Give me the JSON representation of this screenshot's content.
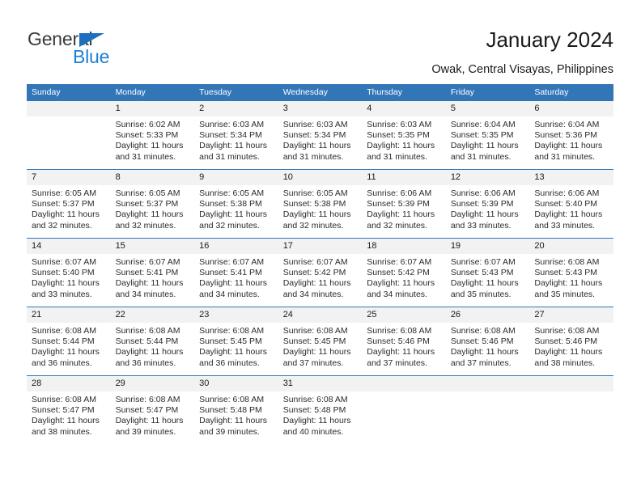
{
  "brand": {
    "name_part1": "General",
    "name_part2": "Blue",
    "triangle_icon": "triangle-icon",
    "accent_blue": "#1b7fd4",
    "dark_gray": "#3a3a3a"
  },
  "header": {
    "title": "January 2024",
    "subtitle": "Owak, Central Visayas, Philippines",
    "header_bg": "#3276b8",
    "daynum_bg": "#f2f2f2"
  },
  "weekday_headers": [
    "Sunday",
    "Monday",
    "Tuesday",
    "Wednesday",
    "Thursday",
    "Friday",
    "Saturday"
  ],
  "weeks": [
    [
      {
        "day": "",
        "sunrise": "",
        "sunset": "",
        "daylight_line1": "",
        "daylight_line2": ""
      },
      {
        "day": "1",
        "sunrise": "Sunrise: 6:02 AM",
        "sunset": "Sunset: 5:33 PM",
        "daylight_line1": "Daylight: 11 hours",
        "daylight_line2": "and 31 minutes."
      },
      {
        "day": "2",
        "sunrise": "Sunrise: 6:03 AM",
        "sunset": "Sunset: 5:34 PM",
        "daylight_line1": "Daylight: 11 hours",
        "daylight_line2": "and 31 minutes."
      },
      {
        "day": "3",
        "sunrise": "Sunrise: 6:03 AM",
        "sunset": "Sunset: 5:34 PM",
        "daylight_line1": "Daylight: 11 hours",
        "daylight_line2": "and 31 minutes."
      },
      {
        "day": "4",
        "sunrise": "Sunrise: 6:03 AM",
        "sunset": "Sunset: 5:35 PM",
        "daylight_line1": "Daylight: 11 hours",
        "daylight_line2": "and 31 minutes."
      },
      {
        "day": "5",
        "sunrise": "Sunrise: 6:04 AM",
        "sunset": "Sunset: 5:35 PM",
        "daylight_line1": "Daylight: 11 hours",
        "daylight_line2": "and 31 minutes."
      },
      {
        "day": "6",
        "sunrise": "Sunrise: 6:04 AM",
        "sunset": "Sunset: 5:36 PM",
        "daylight_line1": "Daylight: 11 hours",
        "daylight_line2": "and 31 minutes."
      }
    ],
    [
      {
        "day": "7",
        "sunrise": "Sunrise: 6:05 AM",
        "sunset": "Sunset: 5:37 PM",
        "daylight_line1": "Daylight: 11 hours",
        "daylight_line2": "and 32 minutes."
      },
      {
        "day": "8",
        "sunrise": "Sunrise: 6:05 AM",
        "sunset": "Sunset: 5:37 PM",
        "daylight_line1": "Daylight: 11 hours",
        "daylight_line2": "and 32 minutes."
      },
      {
        "day": "9",
        "sunrise": "Sunrise: 6:05 AM",
        "sunset": "Sunset: 5:38 PM",
        "daylight_line1": "Daylight: 11 hours",
        "daylight_line2": "and 32 minutes."
      },
      {
        "day": "10",
        "sunrise": "Sunrise: 6:05 AM",
        "sunset": "Sunset: 5:38 PM",
        "daylight_line1": "Daylight: 11 hours",
        "daylight_line2": "and 32 minutes."
      },
      {
        "day": "11",
        "sunrise": "Sunrise: 6:06 AM",
        "sunset": "Sunset: 5:39 PM",
        "daylight_line1": "Daylight: 11 hours",
        "daylight_line2": "and 32 minutes."
      },
      {
        "day": "12",
        "sunrise": "Sunrise: 6:06 AM",
        "sunset": "Sunset: 5:39 PM",
        "daylight_line1": "Daylight: 11 hours",
        "daylight_line2": "and 33 minutes."
      },
      {
        "day": "13",
        "sunrise": "Sunrise: 6:06 AM",
        "sunset": "Sunset: 5:40 PM",
        "daylight_line1": "Daylight: 11 hours",
        "daylight_line2": "and 33 minutes."
      }
    ],
    [
      {
        "day": "14",
        "sunrise": "Sunrise: 6:07 AM",
        "sunset": "Sunset: 5:40 PM",
        "daylight_line1": "Daylight: 11 hours",
        "daylight_line2": "and 33 minutes."
      },
      {
        "day": "15",
        "sunrise": "Sunrise: 6:07 AM",
        "sunset": "Sunset: 5:41 PM",
        "daylight_line1": "Daylight: 11 hours",
        "daylight_line2": "and 34 minutes."
      },
      {
        "day": "16",
        "sunrise": "Sunrise: 6:07 AM",
        "sunset": "Sunset: 5:41 PM",
        "daylight_line1": "Daylight: 11 hours",
        "daylight_line2": "and 34 minutes."
      },
      {
        "day": "17",
        "sunrise": "Sunrise: 6:07 AM",
        "sunset": "Sunset: 5:42 PM",
        "daylight_line1": "Daylight: 11 hours",
        "daylight_line2": "and 34 minutes."
      },
      {
        "day": "18",
        "sunrise": "Sunrise: 6:07 AM",
        "sunset": "Sunset: 5:42 PM",
        "daylight_line1": "Daylight: 11 hours",
        "daylight_line2": "and 34 minutes."
      },
      {
        "day": "19",
        "sunrise": "Sunrise: 6:07 AM",
        "sunset": "Sunset: 5:43 PM",
        "daylight_line1": "Daylight: 11 hours",
        "daylight_line2": "and 35 minutes."
      },
      {
        "day": "20",
        "sunrise": "Sunrise: 6:08 AM",
        "sunset": "Sunset: 5:43 PM",
        "daylight_line1": "Daylight: 11 hours",
        "daylight_line2": "and 35 minutes."
      }
    ],
    [
      {
        "day": "21",
        "sunrise": "Sunrise: 6:08 AM",
        "sunset": "Sunset: 5:44 PM",
        "daylight_line1": "Daylight: 11 hours",
        "daylight_line2": "and 36 minutes."
      },
      {
        "day": "22",
        "sunrise": "Sunrise: 6:08 AM",
        "sunset": "Sunset: 5:44 PM",
        "daylight_line1": "Daylight: 11 hours",
        "daylight_line2": "and 36 minutes."
      },
      {
        "day": "23",
        "sunrise": "Sunrise: 6:08 AM",
        "sunset": "Sunset: 5:45 PM",
        "daylight_line1": "Daylight: 11 hours",
        "daylight_line2": "and 36 minutes."
      },
      {
        "day": "24",
        "sunrise": "Sunrise: 6:08 AM",
        "sunset": "Sunset: 5:45 PM",
        "daylight_line1": "Daylight: 11 hours",
        "daylight_line2": "and 37 minutes."
      },
      {
        "day": "25",
        "sunrise": "Sunrise: 6:08 AM",
        "sunset": "Sunset: 5:46 PM",
        "daylight_line1": "Daylight: 11 hours",
        "daylight_line2": "and 37 minutes."
      },
      {
        "day": "26",
        "sunrise": "Sunrise: 6:08 AM",
        "sunset": "Sunset: 5:46 PM",
        "daylight_line1": "Daylight: 11 hours",
        "daylight_line2": "and 37 minutes."
      },
      {
        "day": "27",
        "sunrise": "Sunrise: 6:08 AM",
        "sunset": "Sunset: 5:46 PM",
        "daylight_line1": "Daylight: 11 hours",
        "daylight_line2": "and 38 minutes."
      }
    ],
    [
      {
        "day": "28",
        "sunrise": "Sunrise: 6:08 AM",
        "sunset": "Sunset: 5:47 PM",
        "daylight_line1": "Daylight: 11 hours",
        "daylight_line2": "and 38 minutes."
      },
      {
        "day": "29",
        "sunrise": "Sunrise: 6:08 AM",
        "sunset": "Sunset: 5:47 PM",
        "daylight_line1": "Daylight: 11 hours",
        "daylight_line2": "and 39 minutes."
      },
      {
        "day": "30",
        "sunrise": "Sunrise: 6:08 AM",
        "sunset": "Sunset: 5:48 PM",
        "daylight_line1": "Daylight: 11 hours",
        "daylight_line2": "and 39 minutes."
      },
      {
        "day": "31",
        "sunrise": "Sunrise: 6:08 AM",
        "sunset": "Sunset: 5:48 PM",
        "daylight_line1": "Daylight: 11 hours",
        "daylight_line2": "and 40 minutes."
      },
      {
        "day": "",
        "sunrise": "",
        "sunset": "",
        "daylight_line1": "",
        "daylight_line2": ""
      },
      {
        "day": "",
        "sunrise": "",
        "sunset": "",
        "daylight_line1": "",
        "daylight_line2": ""
      },
      {
        "day": "",
        "sunrise": "",
        "sunset": "",
        "daylight_line1": "",
        "daylight_line2": ""
      }
    ]
  ]
}
